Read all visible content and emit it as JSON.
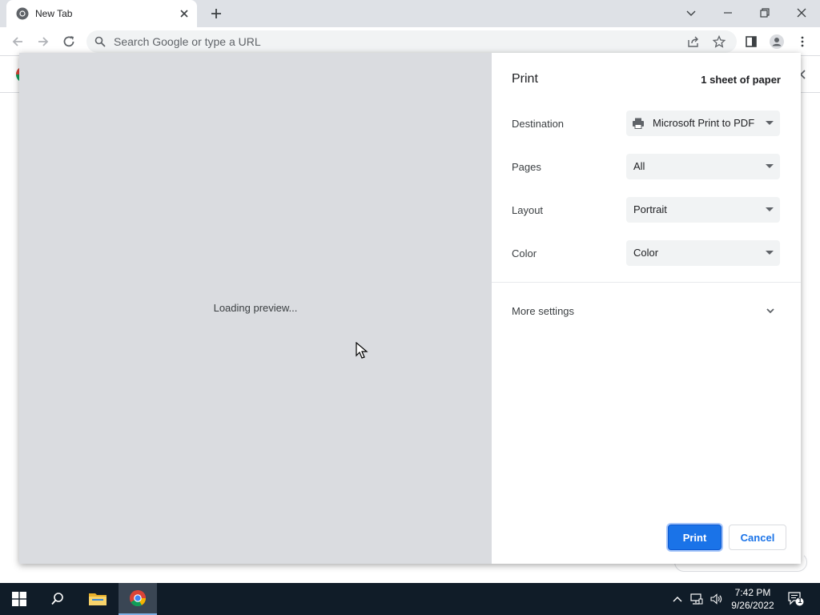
{
  "browser": {
    "tab_title": "New Tab",
    "omnibox_placeholder": "Search Google or type a URL"
  },
  "print_dialog": {
    "title": "Print",
    "sheet_count": "1 sheet of paper",
    "preview_message": "Loading preview...",
    "settings": [
      {
        "label": "Destination",
        "value": "Microsoft Print to PDF",
        "icon": "printer-icon"
      },
      {
        "label": "Pages",
        "value": "All"
      },
      {
        "label": "Layout",
        "value": "Portrait"
      },
      {
        "label": "Color",
        "value": "Color"
      }
    ],
    "more_settings_label": "More settings",
    "print_button": "Print",
    "cancel_button": "Cancel"
  },
  "taskbar": {
    "time": "7:42 PM",
    "date": "9/26/2022",
    "notification_count": "1"
  },
  "colors": {
    "accent": "#1a73e8",
    "preview_bg": "#dadce0",
    "taskbar_bg": "#101c28"
  }
}
